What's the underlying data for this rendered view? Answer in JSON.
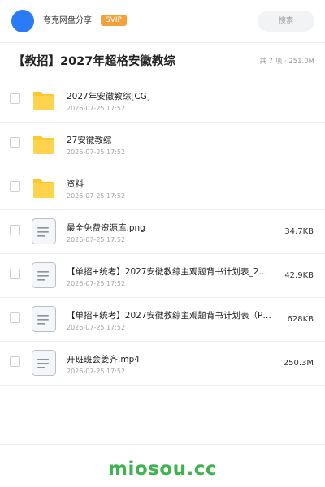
{
  "header": {
    "share_name": "夸克网盘分享",
    "badge": "SVIP",
    "search_label": "搜索",
    "avatar_color": "#2b7bf6"
  },
  "folder": {
    "title": "【教招】2027年超格安徽教综",
    "summary": "共 7 项 · 251.0M"
  },
  "files": [
    {
      "type": "folder",
      "icon": "folder-icon",
      "name": "2027年安徽教综[CG]",
      "date": "2026-07-25 17:52",
      "size": ""
    },
    {
      "type": "folder",
      "icon": "folder-icon",
      "name": "27安徽教综",
      "date": "2026-07-25 17:52",
      "size": ""
    },
    {
      "type": "folder",
      "icon": "folder-icon",
      "name": "资料",
      "date": "2026-07-25 17:52",
      "size": ""
    },
    {
      "type": "file",
      "icon": "document-icon",
      "name": "最全免费资源库.png",
      "date": "2026-07-25 17:52",
      "size": "34.7KB"
    },
    {
      "type": "file",
      "icon": "document-icon",
      "name": "【单招+统考】2027安徽教综主观题背书计划表_2…",
      "date": "2026-07-25 17:52",
      "size": "42.9KB"
    },
    {
      "type": "file",
      "icon": "document-icon",
      "name": "【单招+统考】2027安徽教综主观题背书计划表（P…",
      "date": "2026-07-25 17:52",
      "size": "628KB"
    },
    {
      "type": "file",
      "icon": "document-icon",
      "name": "开班班会姜齐.mp4",
      "date": "2026-07-25 17:52",
      "size": "250.3M"
    }
  ],
  "watermark": "miosou.cc",
  "colors": {
    "accent": "#2b7bf6",
    "svip": "#f5a03a",
    "folder": "#ffc72c",
    "watermark": "#3fb34f"
  }
}
